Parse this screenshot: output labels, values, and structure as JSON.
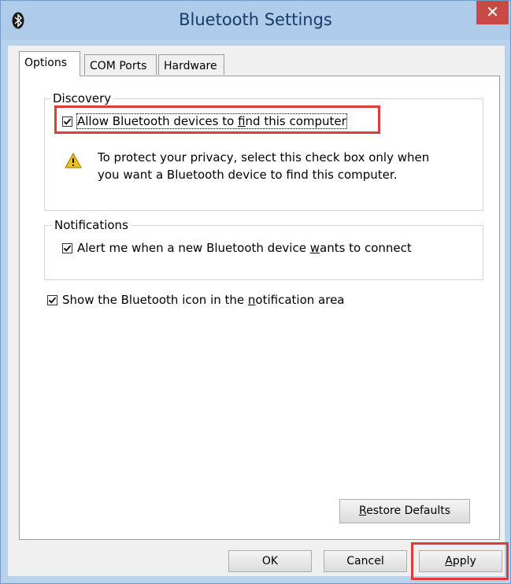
{
  "window": {
    "title": "Bluetooth Settings",
    "close_glyph": "✕",
    "accent_color": "#aecbe9",
    "close_color": "#c74a45"
  },
  "tabs": [
    {
      "label": "Options",
      "active": true
    },
    {
      "label": "COM Ports",
      "active": false
    },
    {
      "label": "Hardware",
      "active": false
    }
  ],
  "discovery": {
    "group_label": "Discovery",
    "allow_checked": true,
    "allow_pre": "Allow Bluetooth devices to ",
    "allow_ul": "f",
    "allow_post": "ind this computer",
    "warning_icon": "warning-triangle",
    "warning_line1": "To protect your privacy, select this check box only when",
    "warning_line2": "you want a Bluetooth device to find this computer."
  },
  "notifications": {
    "group_label": "Notifications",
    "alert_checked": true,
    "alert_pre": "Alert me when a new Bluetooth device ",
    "alert_ul": "w",
    "alert_post": "ants to connect"
  },
  "show_icon": {
    "checked": true,
    "pre": "Show the Bluetooth icon in the ",
    "ul": "n",
    "post": "otification area"
  },
  "buttons": {
    "restore_ul": "R",
    "restore_rest": "estore Defaults",
    "ok": "OK",
    "cancel": "Cancel",
    "apply_ul": "A",
    "apply_rest": "pply"
  },
  "highlight_color": "#e03a3a"
}
